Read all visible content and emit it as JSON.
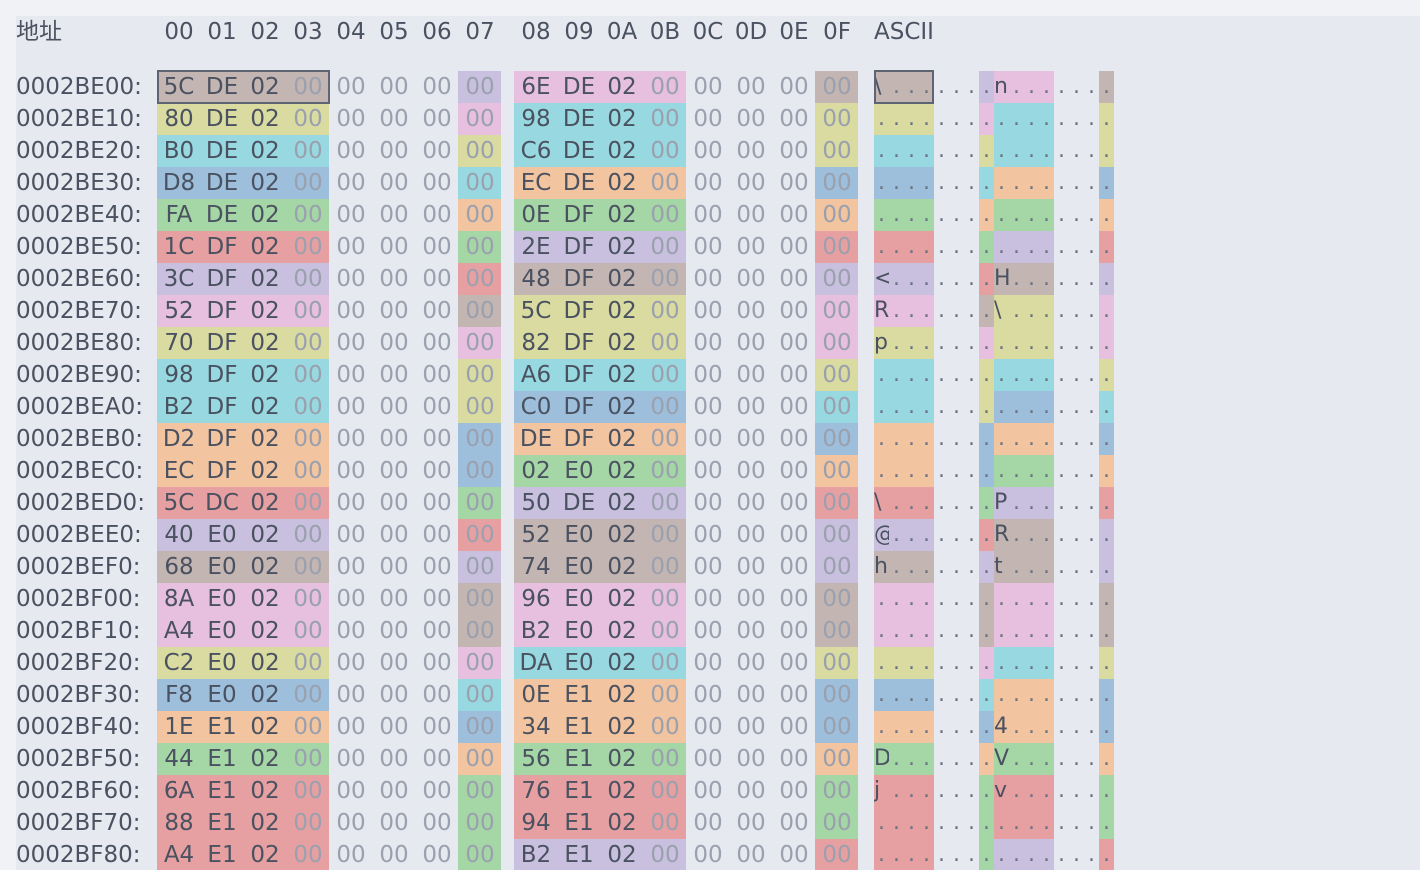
{
  "header": {
    "address_label": "地址",
    "columns": [
      "00",
      "01",
      "02",
      "03",
      "04",
      "05",
      "06",
      "07",
      "08",
      "09",
      "0A",
      "0B",
      "0C",
      "0D",
      "0E",
      "0F"
    ],
    "ascii_label": "ASCII"
  },
  "palette": [
    "#c8c0de",
    "#d9dba1",
    "#98d8e0",
    "#9dbfdb",
    "#f2c49f",
    "#a5d6a5",
    "#e6a0a2",
    "#c3b5b2",
    "#e6c0de"
  ],
  "selection": {
    "offset": "0002BE00",
    "bytes": [
      0,
      1,
      2,
      3
    ]
  },
  "rows": [
    {
      "addr": "0002BE00:",
      "bytes": [
        "5C",
        "DE",
        "02",
        "00",
        "00",
        "00",
        "00",
        "00",
        "6E",
        "DE",
        "02",
        "00",
        "00",
        "00",
        "00",
        "00"
      ],
      "ascii": [
        "\\",
        ".",
        ".",
        ".",
        ".",
        ".",
        ".",
        ".",
        "n",
        ".",
        ".",
        ".",
        ".",
        ".",
        ".",
        "."
      ],
      "colors": [
        7,
        0,
        8,
        7
      ]
    },
    {
      "addr": "0002BE10:",
      "bytes": [
        "80",
        "DE",
        "02",
        "00",
        "00",
        "00",
        "00",
        "00",
        "98",
        "DE",
        "02",
        "00",
        "00",
        "00",
        "00",
        "00"
      ],
      "ascii": [
        ".",
        ".",
        ".",
        ".",
        ".",
        ".",
        ".",
        ".",
        ".",
        ".",
        ".",
        ".",
        ".",
        ".",
        ".",
        "."
      ],
      "colors": [
        1,
        8,
        2,
        1
      ]
    },
    {
      "addr": "0002BE20:",
      "bytes": [
        "B0",
        "DE",
        "02",
        "00",
        "00",
        "00",
        "00",
        "00",
        "C6",
        "DE",
        "02",
        "00",
        "00",
        "00",
        "00",
        "00"
      ],
      "ascii": [
        ".",
        ".",
        ".",
        ".",
        ".",
        ".",
        ".",
        ".",
        ".",
        ".",
        ".",
        ".",
        ".",
        ".",
        ".",
        "."
      ],
      "colors": [
        2,
        1,
        2,
        1
      ]
    },
    {
      "addr": "0002BE30:",
      "bytes": [
        "D8",
        "DE",
        "02",
        "00",
        "00",
        "00",
        "00",
        "00",
        "EC",
        "DE",
        "02",
        "00",
        "00",
        "00",
        "00",
        "00"
      ],
      "ascii": [
        ".",
        ".",
        ".",
        ".",
        ".",
        ".",
        ".",
        ".",
        ".",
        ".",
        ".",
        ".",
        ".",
        ".",
        ".",
        "."
      ],
      "colors": [
        3,
        2,
        4,
        3
      ]
    },
    {
      "addr": "0002BE40:",
      "bytes": [
        "FA",
        "DE",
        "02",
        "00",
        "00",
        "00",
        "00",
        "00",
        "0E",
        "DF",
        "02",
        "00",
        "00",
        "00",
        "00",
        "00"
      ],
      "ascii": [
        ".",
        ".",
        ".",
        ".",
        ".",
        ".",
        ".",
        ".",
        ".",
        ".",
        ".",
        ".",
        ".",
        ".",
        ".",
        "."
      ],
      "colors": [
        5,
        4,
        5,
        4
      ]
    },
    {
      "addr": "0002BE50:",
      "bytes": [
        "1C",
        "DF",
        "02",
        "00",
        "00",
        "00",
        "00",
        "00",
        "2E",
        "DF",
        "02",
        "00",
        "00",
        "00",
        "00",
        "00"
      ],
      "ascii": [
        ".",
        ".",
        ".",
        ".",
        ".",
        ".",
        ".",
        ".",
        ".",
        ".",
        ".",
        ".",
        ".",
        ".",
        ".",
        "."
      ],
      "colors": [
        6,
        5,
        0,
        6
      ]
    },
    {
      "addr": "0002BE60:",
      "bytes": [
        "3C",
        "DF",
        "02",
        "00",
        "00",
        "00",
        "00",
        "00",
        "48",
        "DF",
        "02",
        "00",
        "00",
        "00",
        "00",
        "00"
      ],
      "ascii": [
        "<",
        ".",
        ".",
        ".",
        ".",
        ".",
        ".",
        ".",
        "H",
        ".",
        ".",
        ".",
        ".",
        ".",
        ".",
        "."
      ],
      "colors": [
        0,
        6,
        7,
        0
      ]
    },
    {
      "addr": "0002BE70:",
      "bytes": [
        "52",
        "DF",
        "02",
        "00",
        "00",
        "00",
        "00",
        "00",
        "5C",
        "DF",
        "02",
        "00",
        "00",
        "00",
        "00",
        "00"
      ],
      "ascii": [
        "R",
        ".",
        ".",
        ".",
        ".",
        ".",
        ".",
        ".",
        "\\",
        ".",
        ".",
        ".",
        ".",
        ".",
        ".",
        "."
      ],
      "colors": [
        8,
        7,
        1,
        8
      ]
    },
    {
      "addr": "0002BE80:",
      "bytes": [
        "70",
        "DF",
        "02",
        "00",
        "00",
        "00",
        "00",
        "00",
        "82",
        "DF",
        "02",
        "00",
        "00",
        "00",
        "00",
        "00"
      ],
      "ascii": [
        "p",
        ".",
        ".",
        ".",
        ".",
        ".",
        ".",
        ".",
        ".",
        ".",
        ".",
        ".",
        ".",
        ".",
        ".",
        "."
      ],
      "colors": [
        1,
        8,
        1,
        8
      ]
    },
    {
      "addr": "0002BE90:",
      "bytes": [
        "98",
        "DF",
        "02",
        "00",
        "00",
        "00",
        "00",
        "00",
        "A6",
        "DF",
        "02",
        "00",
        "00",
        "00",
        "00",
        "00"
      ],
      "ascii": [
        ".",
        ".",
        ".",
        ".",
        ".",
        ".",
        ".",
        ".",
        ".",
        ".",
        ".",
        ".",
        ".",
        ".",
        ".",
        "."
      ],
      "colors": [
        2,
        1,
        2,
        1
      ]
    },
    {
      "addr": "0002BEA0:",
      "bytes": [
        "B2",
        "DF",
        "02",
        "00",
        "00",
        "00",
        "00",
        "00",
        "C0",
        "DF",
        "02",
        "00",
        "00",
        "00",
        "00",
        "00"
      ],
      "ascii": [
        ".",
        ".",
        ".",
        ".",
        ".",
        ".",
        ".",
        ".",
        ".",
        ".",
        ".",
        ".",
        ".",
        ".",
        ".",
        "."
      ],
      "colors": [
        2,
        1,
        3,
        2
      ]
    },
    {
      "addr": "0002BEB0:",
      "bytes": [
        "D2",
        "DF",
        "02",
        "00",
        "00",
        "00",
        "00",
        "00",
        "DE",
        "DF",
        "02",
        "00",
        "00",
        "00",
        "00",
        "00"
      ],
      "ascii": [
        ".",
        ".",
        ".",
        ".",
        ".",
        ".",
        ".",
        ".",
        ".",
        ".",
        ".",
        ".",
        ".",
        ".",
        ".",
        "."
      ],
      "colors": [
        4,
        3,
        4,
        3
      ]
    },
    {
      "addr": "0002BEC0:",
      "bytes": [
        "EC",
        "DF",
        "02",
        "00",
        "00",
        "00",
        "00",
        "00",
        "02",
        "E0",
        "02",
        "00",
        "00",
        "00",
        "00",
        "00"
      ],
      "ascii": [
        ".",
        ".",
        ".",
        ".",
        ".",
        ".",
        ".",
        ".",
        ".",
        ".",
        ".",
        ".",
        ".",
        ".",
        ".",
        "."
      ],
      "colors": [
        4,
        3,
        5,
        4
      ]
    },
    {
      "addr": "0002BED0:",
      "bytes": [
        "5C",
        "DC",
        "02",
        "00",
        "00",
        "00",
        "00",
        "00",
        "50",
        "DE",
        "02",
        "00",
        "00",
        "00",
        "00",
        "00"
      ],
      "ascii": [
        "\\",
        ".",
        ".",
        ".",
        ".",
        ".",
        ".",
        ".",
        "P",
        ".",
        ".",
        ".",
        ".",
        ".",
        ".",
        "."
      ],
      "colors": [
        6,
        5,
        0,
        6
      ]
    },
    {
      "addr": "0002BEE0:",
      "bytes": [
        "40",
        "E0",
        "02",
        "00",
        "00",
        "00",
        "00",
        "00",
        "52",
        "E0",
        "02",
        "00",
        "00",
        "00",
        "00",
        "00"
      ],
      "ascii": [
        "@",
        ".",
        ".",
        ".",
        ".",
        ".",
        ".",
        ".",
        "R",
        ".",
        ".",
        ".",
        ".",
        ".",
        ".",
        "."
      ],
      "colors": [
        0,
        6,
        7,
        0
      ]
    },
    {
      "addr": "0002BEF0:",
      "bytes": [
        "68",
        "E0",
        "02",
        "00",
        "00",
        "00",
        "00",
        "00",
        "74",
        "E0",
        "02",
        "00",
        "00",
        "00",
        "00",
        "00"
      ],
      "ascii": [
        "h",
        ".",
        ".",
        ".",
        ".",
        ".",
        ".",
        ".",
        "t",
        ".",
        ".",
        ".",
        ".",
        ".",
        ".",
        "."
      ],
      "colors": [
        7,
        0,
        7,
        0
      ]
    },
    {
      "addr": "0002BF00:",
      "bytes": [
        "8A",
        "E0",
        "02",
        "00",
        "00",
        "00",
        "00",
        "00",
        "96",
        "E0",
        "02",
        "00",
        "00",
        "00",
        "00",
        "00"
      ],
      "ascii": [
        ".",
        ".",
        ".",
        ".",
        ".",
        ".",
        ".",
        ".",
        ".",
        ".",
        ".",
        ".",
        ".",
        ".",
        ".",
        "."
      ],
      "colors": [
        8,
        7,
        8,
        7
      ]
    },
    {
      "addr": "0002BF10:",
      "bytes": [
        "A4",
        "E0",
        "02",
        "00",
        "00",
        "00",
        "00",
        "00",
        "B2",
        "E0",
        "02",
        "00",
        "00",
        "00",
        "00",
        "00"
      ],
      "ascii": [
        ".",
        ".",
        ".",
        ".",
        ".",
        ".",
        ".",
        ".",
        ".",
        ".",
        ".",
        ".",
        ".",
        ".",
        ".",
        "."
      ],
      "colors": [
        8,
        7,
        8,
        7
      ]
    },
    {
      "addr": "0002BF20:",
      "bytes": [
        "C2",
        "E0",
        "02",
        "00",
        "00",
        "00",
        "00",
        "00",
        "DA",
        "E0",
        "02",
        "00",
        "00",
        "00",
        "00",
        "00"
      ],
      "ascii": [
        ".",
        ".",
        ".",
        ".",
        ".",
        ".",
        ".",
        ".",
        ".",
        ".",
        ".",
        ".",
        ".",
        ".",
        ".",
        "."
      ],
      "colors": [
        1,
        8,
        2,
        1
      ]
    },
    {
      "addr": "0002BF30:",
      "bytes": [
        "F8",
        "E0",
        "02",
        "00",
        "00",
        "00",
        "00",
        "00",
        "0E",
        "E1",
        "02",
        "00",
        "00",
        "00",
        "00",
        "00"
      ],
      "ascii": [
        ".",
        ".",
        ".",
        ".",
        ".",
        ".",
        ".",
        ".",
        ".",
        ".",
        ".",
        ".",
        ".",
        ".",
        ".",
        "."
      ],
      "colors": [
        3,
        2,
        4,
        3
      ]
    },
    {
      "addr": "0002BF40:",
      "bytes": [
        "1E",
        "E1",
        "02",
        "00",
        "00",
        "00",
        "00",
        "00",
        "34",
        "E1",
        "02",
        "00",
        "00",
        "00",
        "00",
        "00"
      ],
      "ascii": [
        ".",
        ".",
        ".",
        ".",
        ".",
        ".",
        ".",
        ".",
        "4",
        ".",
        ".",
        ".",
        ".",
        ".",
        ".",
        "."
      ],
      "colors": [
        4,
        3,
        4,
        3
      ]
    },
    {
      "addr": "0002BF50:",
      "bytes": [
        "44",
        "E1",
        "02",
        "00",
        "00",
        "00",
        "00",
        "00",
        "56",
        "E1",
        "02",
        "00",
        "00",
        "00",
        "00",
        "00"
      ],
      "ascii": [
        "D",
        ".",
        ".",
        ".",
        ".",
        ".",
        ".",
        ".",
        "V",
        ".",
        ".",
        ".",
        ".",
        ".",
        ".",
        "."
      ],
      "colors": [
        5,
        4,
        5,
        4
      ]
    },
    {
      "addr": "0002BF60:",
      "bytes": [
        "6A",
        "E1",
        "02",
        "00",
        "00",
        "00",
        "00",
        "00",
        "76",
        "E1",
        "02",
        "00",
        "00",
        "00",
        "00",
        "00"
      ],
      "ascii": [
        "j",
        ".",
        ".",
        ".",
        ".",
        ".",
        ".",
        ".",
        "v",
        ".",
        ".",
        ".",
        ".",
        ".",
        ".",
        "."
      ],
      "colors": [
        6,
        5,
        6,
        5
      ]
    },
    {
      "addr": "0002BF70:",
      "bytes": [
        "88",
        "E1",
        "02",
        "00",
        "00",
        "00",
        "00",
        "00",
        "94",
        "E1",
        "02",
        "00",
        "00",
        "00",
        "00",
        "00"
      ],
      "ascii": [
        ".",
        ".",
        ".",
        ".",
        ".",
        ".",
        ".",
        ".",
        ".",
        ".",
        ".",
        ".",
        ".",
        ".",
        ".",
        "."
      ],
      "colors": [
        6,
        5,
        6,
        5
      ]
    },
    {
      "addr": "0002BF80:",
      "bytes": [
        "A4",
        "E1",
        "02",
        "00",
        "00",
        "00",
        "00",
        "00",
        "B2",
        "E1",
        "02",
        "00",
        "00",
        "00",
        "00",
        "00"
      ],
      "ascii": [
        ".",
        ".",
        ".",
        ".",
        ".",
        ".",
        ".",
        ".",
        ".",
        ".",
        ".",
        ".",
        ".",
        ".",
        ".",
        "."
      ],
      "colors": [
        6,
        5,
        0,
        6
      ]
    }
  ]
}
